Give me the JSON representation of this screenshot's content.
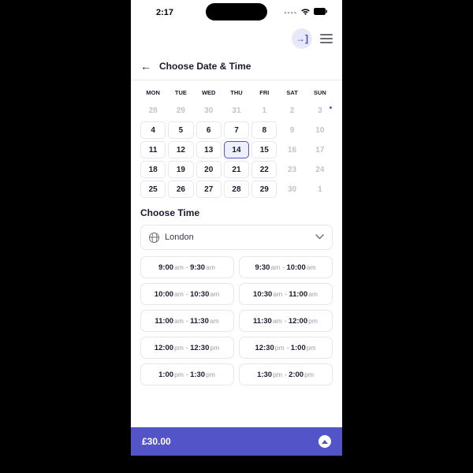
{
  "status": {
    "time": "2:17"
  },
  "header": {
    "title": "Choose Date & Time"
  },
  "calendar": {
    "dow": [
      "MON",
      "TUE",
      "WED",
      "THU",
      "FRI",
      "SAT",
      "SUN"
    ],
    "days": [
      {
        "n": "28",
        "state": "disabled"
      },
      {
        "n": "29",
        "state": "disabled"
      },
      {
        "n": "30",
        "state": "disabled"
      },
      {
        "n": "31",
        "state": "disabled"
      },
      {
        "n": "1",
        "state": "disabled"
      },
      {
        "n": "2",
        "state": "disabled"
      },
      {
        "n": "3",
        "state": "disabled"
      },
      {
        "n": "4",
        "state": "enabled"
      },
      {
        "n": "5",
        "state": "enabled"
      },
      {
        "n": "6",
        "state": "enabled"
      },
      {
        "n": "7",
        "state": "enabled"
      },
      {
        "n": "8",
        "state": "enabled"
      },
      {
        "n": "9",
        "state": "disabled"
      },
      {
        "n": "10",
        "state": "disabled"
      },
      {
        "n": "11",
        "state": "enabled"
      },
      {
        "n": "12",
        "state": "enabled"
      },
      {
        "n": "13",
        "state": "enabled"
      },
      {
        "n": "14",
        "state": "selected"
      },
      {
        "n": "15",
        "state": "enabled"
      },
      {
        "n": "16",
        "state": "disabled"
      },
      {
        "n": "17",
        "state": "disabled"
      },
      {
        "n": "18",
        "state": "enabled"
      },
      {
        "n": "19",
        "state": "enabled"
      },
      {
        "n": "20",
        "state": "enabled"
      },
      {
        "n": "21",
        "state": "enabled"
      },
      {
        "n": "22",
        "state": "enabled"
      },
      {
        "n": "23",
        "state": "disabled"
      },
      {
        "n": "24",
        "state": "disabled"
      },
      {
        "n": "25",
        "state": "enabled"
      },
      {
        "n": "26",
        "state": "enabled"
      },
      {
        "n": "27",
        "state": "enabled"
      },
      {
        "n": "28",
        "state": "enabled"
      },
      {
        "n": "29",
        "state": "enabled"
      },
      {
        "n": "30",
        "state": "disabled"
      },
      {
        "n": "1",
        "state": "disabled"
      }
    ]
  },
  "time_section": {
    "title": "Choose Time",
    "timezone": "London",
    "slots": [
      {
        "s": "9:00",
        "sp": "am",
        "e": "9:30",
        "ep": "am"
      },
      {
        "s": "9:30",
        "sp": "am",
        "e": "10:00",
        "ep": "am"
      },
      {
        "s": "10:00",
        "sp": "am",
        "e": "10:30",
        "ep": "am"
      },
      {
        "s": "10:30",
        "sp": "am",
        "e": "11:00",
        "ep": "am"
      },
      {
        "s": "11:00",
        "sp": "am",
        "e": "11:30",
        "ep": "am"
      },
      {
        "s": "11:30",
        "sp": "am",
        "e": "12:00",
        "ep": "pm"
      },
      {
        "s": "12:00",
        "sp": "pm",
        "e": "12:30",
        "ep": "pm"
      },
      {
        "s": "12:30",
        "sp": "pm",
        "e": "1:00",
        "ep": "pm"
      },
      {
        "s": "1:00",
        "sp": "pm",
        "e": "1:30",
        "ep": "pm"
      },
      {
        "s": "1:30",
        "sp": "pm",
        "e": "2:00",
        "ep": "pm"
      }
    ]
  },
  "footer": {
    "price": "£30.00"
  }
}
